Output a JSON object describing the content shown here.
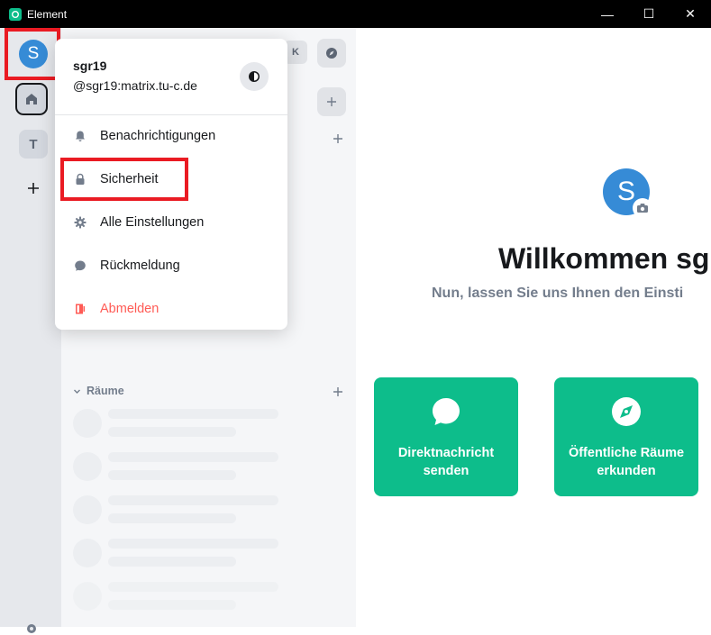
{
  "window": {
    "title": "Element",
    "controls": {
      "minimize": "—",
      "maximize": "☐",
      "close": "✕"
    }
  },
  "spacebar": {
    "user_initial": "S",
    "spaces": [
      {
        "initial": "T"
      }
    ]
  },
  "roomlist": {
    "shortcut_key": "K",
    "sections": [
      {
        "label": "Räume"
      }
    ]
  },
  "user_menu": {
    "display_name": "sgr19",
    "matrix_id": "@sgr19:matrix.tu-c.de",
    "items": [
      {
        "label": "Benachrichtigungen",
        "icon": "bell-icon"
      },
      {
        "label": "Sicherheit",
        "icon": "lock-icon"
      },
      {
        "label": "Alle Einstellungen",
        "icon": "gear-icon"
      },
      {
        "label": "Rückmeldung",
        "icon": "chat-bubble-icon"
      },
      {
        "label": "Abmelden",
        "icon": "sign-out-icon"
      }
    ]
  },
  "main": {
    "avatar_initial": "S",
    "welcome_title": "Willkommen sg",
    "welcome_subtitle": "Nun, lassen Sie uns Ihnen den Einsti",
    "cards": [
      {
        "line1": "Direktnachricht",
        "line2": "senden",
        "icon": "chat-bubble-icon"
      },
      {
        "line1": "Öffentliche Räume",
        "line2": "erkunden",
        "icon": "compass-icon"
      }
    ]
  },
  "colors": {
    "accent": "#0dbd8b",
    "avatar": "#368bd6",
    "danger": "#ff5b55",
    "highlight": "#ea1b23"
  }
}
